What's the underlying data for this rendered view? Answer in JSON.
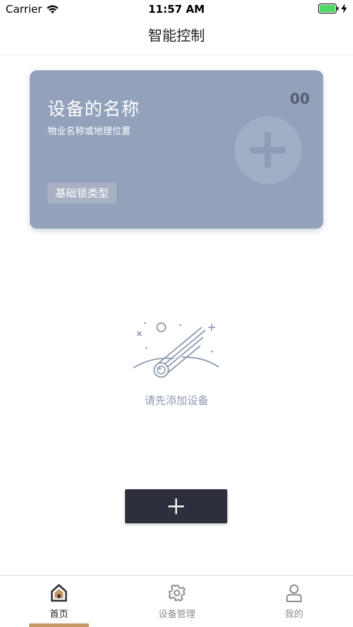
{
  "status_bar": {
    "carrier": "Carrier",
    "time": "11:57 AM",
    "battery_color": "#4cd964"
  },
  "nav": {
    "title": "智能控制"
  },
  "device_card": {
    "name": "设备的名称",
    "location": "物业名称或地理位置",
    "code": "00",
    "lock_type": "基础锁类型",
    "background": "#93a1bb"
  },
  "empty_state": {
    "message": "请先添加设备",
    "icon": "meteor-illustration"
  },
  "add_button": {
    "icon": "plus-icon"
  },
  "tab_bar": {
    "active_color": "#c39862",
    "tabs": [
      {
        "label": "首页",
        "icon": "home-icon",
        "active": true
      },
      {
        "label": "设备管理",
        "icon": "gear-icon",
        "active": false
      },
      {
        "label": "我的",
        "icon": "user-icon",
        "active": false
      }
    ]
  }
}
